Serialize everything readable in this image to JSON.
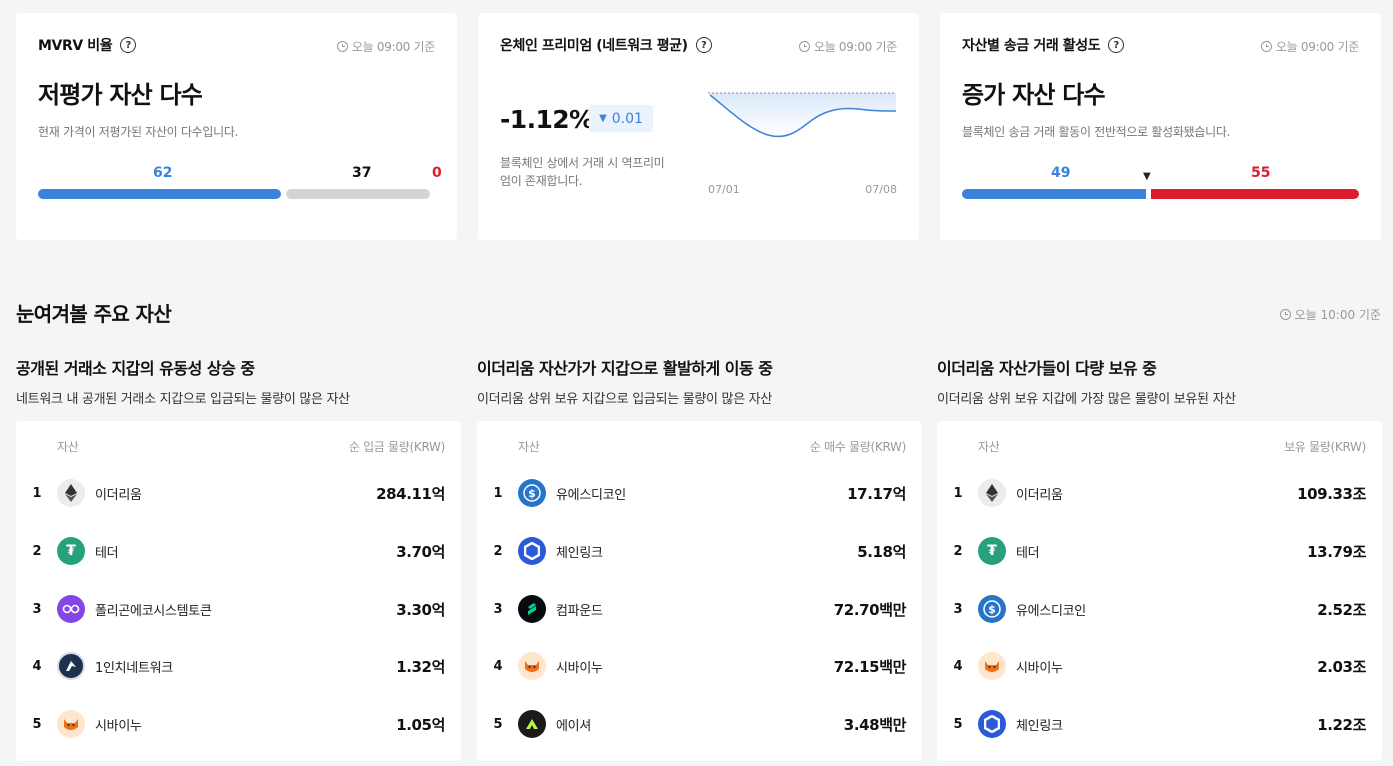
{
  "colors": {
    "blue": "#3b82db",
    "red": "#dc1c2c",
    "gray": "#d4d4d4"
  },
  "cards": [
    {
      "title": "MVRV 비율",
      "time": "오늘 09:00 기준",
      "headline": "저평가 자산 다수",
      "desc": "현재 가격이 저평가된 자산이 다수입니다.",
      "values": {
        "undervalued": "62",
        "neutral": "37",
        "overvalued": "0"
      }
    },
    {
      "title": "온체인 프리미엄 (네트워크 평균)",
      "time": "오늘 09:00 기준",
      "value": "-1.12%",
      "change": "0.01",
      "desc_line1": "블록체인 상에서 거래 시 역프리미",
      "desc_line2": "엄이 존재합니다.",
      "x_start": "07/01",
      "x_end": "07/08"
    },
    {
      "title": "자산별 송금 거래 활성도",
      "time": "오늘 09:00 기준",
      "headline": "증가 자산 다수",
      "desc": "블록체인 송금 거래 활동이 전반적으로 활성화됐습니다.",
      "values": {
        "decrease": "49",
        "increase": "55"
      }
    }
  ],
  "section": {
    "title": "눈여겨볼 주요 자산",
    "time": "오늘 10:00 기준"
  },
  "columns": [
    {
      "title": "공개된 거래소 지갑의 유동성 상승 중",
      "desc": "네트워크 내 공개된 거래소 지갑으로 입금되는 물량이 많은 자산",
      "header_asset": "자산",
      "header_value": "순 입금 물량(KRW)",
      "rows": [
        {
          "rank": "1",
          "icon": "ethereum-icon",
          "name": "이더리움",
          "amount": "284.11억"
        },
        {
          "rank": "2",
          "icon": "tether-icon",
          "name": "테더",
          "amount": "3.70억"
        },
        {
          "rank": "3",
          "icon": "polygon-icon",
          "name": "폴리곤에코시스템토큰",
          "amount": "3.30억"
        },
        {
          "rank": "4",
          "icon": "1inch-icon",
          "name": "1인치네트워크",
          "amount": "1.32억"
        },
        {
          "rank": "5",
          "icon": "shiba-inu-icon",
          "name": "시바이누",
          "amount": "1.05억"
        }
      ]
    },
    {
      "title": "이더리움 자산가가 지갑으로 활발하게 이동 중",
      "desc": "이더리움 상위 보유 지갑으로 입금되는 물량이 많은 자산",
      "header_asset": "자산",
      "header_value": "순 매수 물량(KRW)",
      "rows": [
        {
          "rank": "1",
          "icon": "usdc-icon",
          "name": "유에스디코인",
          "amount": "17.17억"
        },
        {
          "rank": "2",
          "icon": "chainlink-icon",
          "name": "체인링크",
          "amount": "5.18억"
        },
        {
          "rank": "3",
          "icon": "compound-icon",
          "name": "컴파운드",
          "amount": "72.70백만"
        },
        {
          "rank": "4",
          "icon": "shiba-inu-icon",
          "name": "시바이누",
          "amount": "72.15백만"
        },
        {
          "rank": "5",
          "icon": "aethir-icon",
          "name": "에이셔",
          "amount": "3.48백만"
        }
      ]
    },
    {
      "title": "이더리움 자산가들이 다량 보유 중",
      "desc": "이더리움 상위 보유 지갑에 가장 많은 물량이 보유된 자산",
      "header_asset": "자산",
      "header_value": "보유 물량(KRW)",
      "rows": [
        {
          "rank": "1",
          "icon": "ethereum-icon",
          "name": "이더리움",
          "amount": "109.33조"
        },
        {
          "rank": "2",
          "icon": "tether-icon",
          "name": "테더",
          "amount": "13.79조"
        },
        {
          "rank": "3",
          "icon": "usdc-icon",
          "name": "유에스디코인",
          "amount": "2.52조"
        },
        {
          "rank": "4",
          "icon": "shiba-inu-icon",
          "name": "시바이누",
          "amount": "2.03조"
        },
        {
          "rank": "5",
          "icon": "chainlink-icon",
          "name": "체인링크",
          "amount": "1.22조"
        }
      ]
    }
  ]
}
